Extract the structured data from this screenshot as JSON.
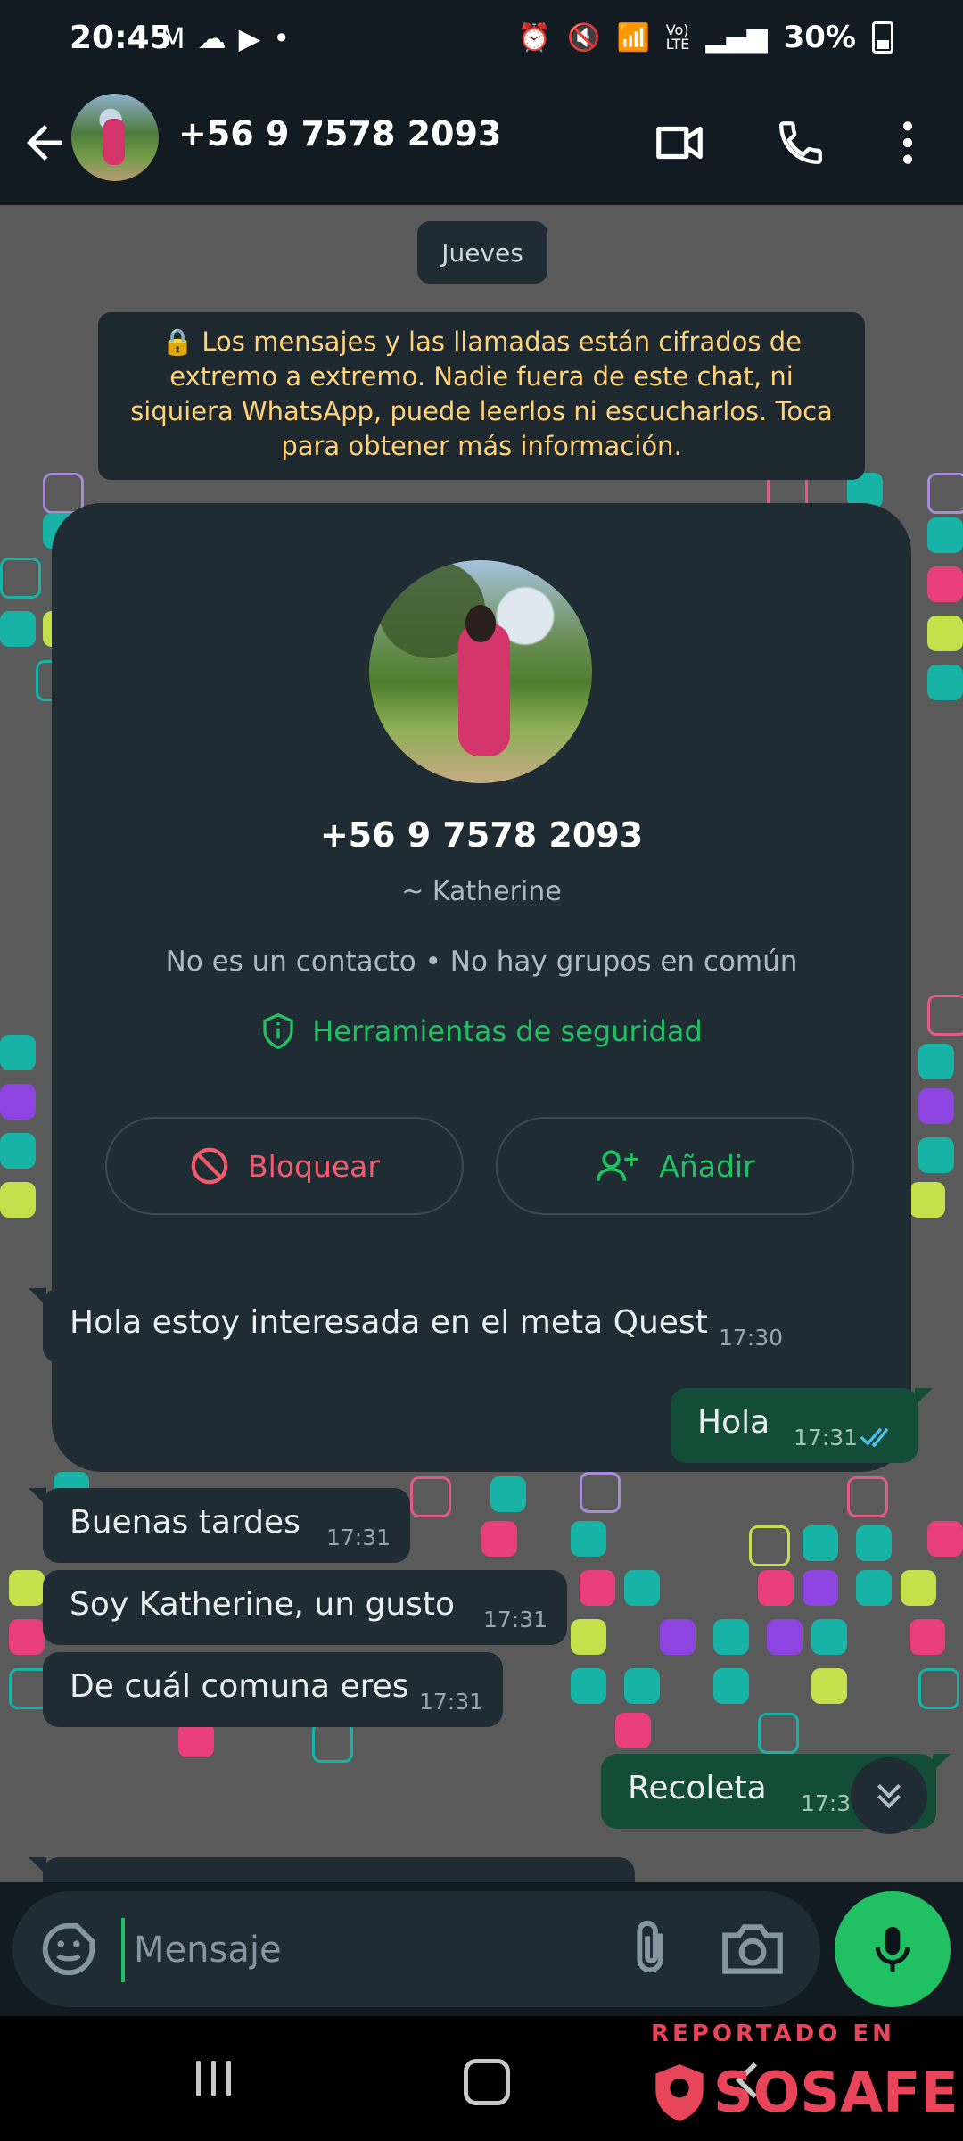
{
  "status_bar": {
    "time": "20:45",
    "battery": "30%"
  },
  "app_bar": {
    "title": "+56 9 7578 2093"
  },
  "chat": {
    "date_chip": "Jueves",
    "encryption_notice": "🔒 Los mensajes y las llamadas están cifrados de extremo a extremo. Nadie fuera de este chat, ni siquiera WhatsApp, puede leerlos ni escucharlos. Toca para obtener más información.",
    "contact_card": {
      "phone": "+56 9 7578 2093",
      "name": "~ Katherine",
      "info": "No es un contacto • No hay grupos en común",
      "safety_tools": "Herramientas de seguridad",
      "block_label": "Bloquear",
      "add_label": "Añadir"
    },
    "messages": [
      {
        "direction": "in",
        "text": "Hola estoy interesada en el meta Quest",
        "time": "17:30"
      },
      {
        "direction": "out",
        "text": "Hola",
        "time": "17:31"
      },
      {
        "direction": "in",
        "text": "Buenas tardes",
        "time": "17:31"
      },
      {
        "direction": "in",
        "text": "Soy Katherine, un gusto",
        "time": "17:31"
      },
      {
        "direction": "in",
        "text": "De cuál comuna eres",
        "time": "17:31"
      },
      {
        "direction": "out",
        "text": "Recoleta",
        "time": "17:31"
      }
    ]
  },
  "input": {
    "placeholder": "Mensaje"
  },
  "watermark": {
    "top": "REPORTADO EN",
    "brand": "SOSAFE"
  },
  "colors": {
    "accent_green": "#21c063",
    "danger_red": "#f15c6d",
    "wallpaper": "#5a5a5a",
    "bubble_in": "#1f2c33",
    "bubble_out": "#144d37"
  }
}
